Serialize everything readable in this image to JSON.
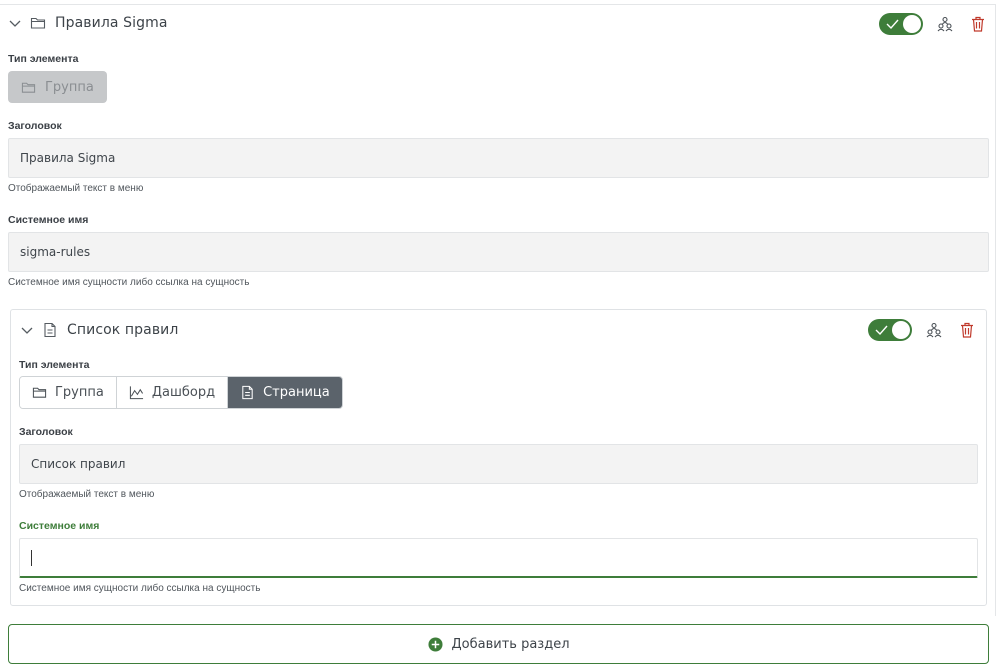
{
  "section": {
    "title": "Правила Sigma",
    "type_label": "Тип элемента",
    "type_value": "Группа",
    "heading_label": "Заголовок",
    "heading_value": "Правила Sigma",
    "heading_hint": "Отображаемый текст в меню",
    "sysname_label": "Системное имя",
    "sysname_value": "sigma-rules",
    "sysname_hint": "Системное имя сущности либо ссылка на сущность",
    "enabled": true
  },
  "subsection": {
    "title": "Список правил",
    "type_label": "Тип элемента",
    "type_options": [
      "Группа",
      "Дашборд",
      "Страница"
    ],
    "type_selected": "Страница",
    "heading_label": "Заголовок",
    "heading_value": "Список правил",
    "heading_hint": "Отображаемый текст в меню",
    "sysname_label": "Системное имя",
    "sysname_value": "",
    "sysname_hint": "Системное имя сущности либо ссылка на сущность",
    "enabled": true
  },
  "add_button_label": "Добавить раздел",
  "colors": {
    "accent": "#3e7d3a",
    "danger": "#c0392b",
    "selected_segment": "#5b636b"
  }
}
